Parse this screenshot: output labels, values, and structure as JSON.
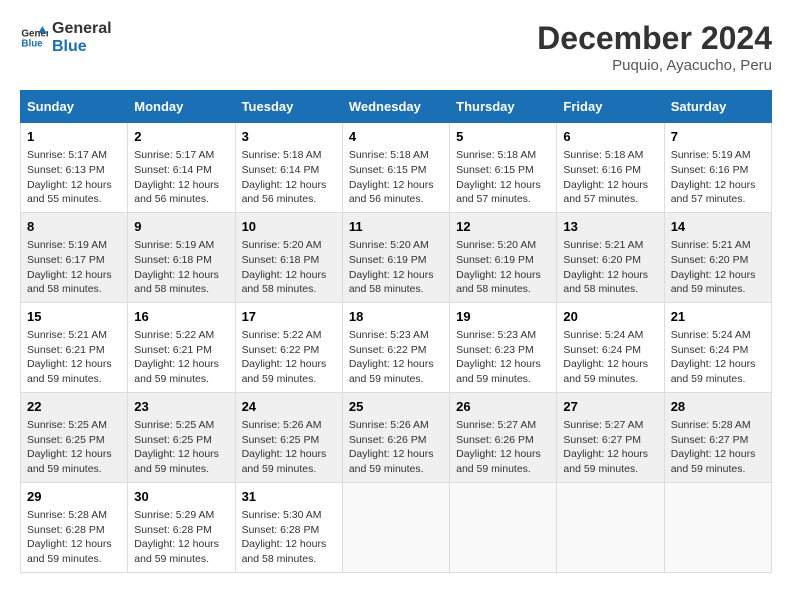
{
  "logo": {
    "line1": "General",
    "line2": "Blue"
  },
  "title": "December 2024",
  "subtitle": "Puquio, Ayacucho, Peru",
  "days_of_week": [
    "Sunday",
    "Monday",
    "Tuesday",
    "Wednesday",
    "Thursday",
    "Friday",
    "Saturday"
  ],
  "weeks": [
    [
      {
        "day": "1",
        "sunrise": "Sunrise: 5:17 AM",
        "sunset": "Sunset: 6:13 PM",
        "daylight": "Daylight: 12 hours and 55 minutes."
      },
      {
        "day": "2",
        "sunrise": "Sunrise: 5:17 AM",
        "sunset": "Sunset: 6:14 PM",
        "daylight": "Daylight: 12 hours and 56 minutes."
      },
      {
        "day": "3",
        "sunrise": "Sunrise: 5:18 AM",
        "sunset": "Sunset: 6:14 PM",
        "daylight": "Daylight: 12 hours and 56 minutes."
      },
      {
        "day": "4",
        "sunrise": "Sunrise: 5:18 AM",
        "sunset": "Sunset: 6:15 PM",
        "daylight": "Daylight: 12 hours and 56 minutes."
      },
      {
        "day": "5",
        "sunrise": "Sunrise: 5:18 AM",
        "sunset": "Sunset: 6:15 PM",
        "daylight": "Daylight: 12 hours and 57 minutes."
      },
      {
        "day": "6",
        "sunrise": "Sunrise: 5:18 AM",
        "sunset": "Sunset: 6:16 PM",
        "daylight": "Daylight: 12 hours and 57 minutes."
      },
      {
        "day": "7",
        "sunrise": "Sunrise: 5:19 AM",
        "sunset": "Sunset: 6:16 PM",
        "daylight": "Daylight: 12 hours and 57 minutes."
      }
    ],
    [
      {
        "day": "8",
        "sunrise": "Sunrise: 5:19 AM",
        "sunset": "Sunset: 6:17 PM",
        "daylight": "Daylight: 12 hours and 58 minutes."
      },
      {
        "day": "9",
        "sunrise": "Sunrise: 5:19 AM",
        "sunset": "Sunset: 6:18 PM",
        "daylight": "Daylight: 12 hours and 58 minutes."
      },
      {
        "day": "10",
        "sunrise": "Sunrise: 5:20 AM",
        "sunset": "Sunset: 6:18 PM",
        "daylight": "Daylight: 12 hours and 58 minutes."
      },
      {
        "day": "11",
        "sunrise": "Sunrise: 5:20 AM",
        "sunset": "Sunset: 6:19 PM",
        "daylight": "Daylight: 12 hours and 58 minutes."
      },
      {
        "day": "12",
        "sunrise": "Sunrise: 5:20 AM",
        "sunset": "Sunset: 6:19 PM",
        "daylight": "Daylight: 12 hours and 58 minutes."
      },
      {
        "day": "13",
        "sunrise": "Sunrise: 5:21 AM",
        "sunset": "Sunset: 6:20 PM",
        "daylight": "Daylight: 12 hours and 58 minutes."
      },
      {
        "day": "14",
        "sunrise": "Sunrise: 5:21 AM",
        "sunset": "Sunset: 6:20 PM",
        "daylight": "Daylight: 12 hours and 59 minutes."
      }
    ],
    [
      {
        "day": "15",
        "sunrise": "Sunrise: 5:21 AM",
        "sunset": "Sunset: 6:21 PM",
        "daylight": "Daylight: 12 hours and 59 minutes."
      },
      {
        "day": "16",
        "sunrise": "Sunrise: 5:22 AM",
        "sunset": "Sunset: 6:21 PM",
        "daylight": "Daylight: 12 hours and 59 minutes."
      },
      {
        "day": "17",
        "sunrise": "Sunrise: 5:22 AM",
        "sunset": "Sunset: 6:22 PM",
        "daylight": "Daylight: 12 hours and 59 minutes."
      },
      {
        "day": "18",
        "sunrise": "Sunrise: 5:23 AM",
        "sunset": "Sunset: 6:22 PM",
        "daylight": "Daylight: 12 hours and 59 minutes."
      },
      {
        "day": "19",
        "sunrise": "Sunrise: 5:23 AM",
        "sunset": "Sunset: 6:23 PM",
        "daylight": "Daylight: 12 hours and 59 minutes."
      },
      {
        "day": "20",
        "sunrise": "Sunrise: 5:24 AM",
        "sunset": "Sunset: 6:24 PM",
        "daylight": "Daylight: 12 hours and 59 minutes."
      },
      {
        "day": "21",
        "sunrise": "Sunrise: 5:24 AM",
        "sunset": "Sunset: 6:24 PM",
        "daylight": "Daylight: 12 hours and 59 minutes."
      }
    ],
    [
      {
        "day": "22",
        "sunrise": "Sunrise: 5:25 AM",
        "sunset": "Sunset: 6:25 PM",
        "daylight": "Daylight: 12 hours and 59 minutes."
      },
      {
        "day": "23",
        "sunrise": "Sunrise: 5:25 AM",
        "sunset": "Sunset: 6:25 PM",
        "daylight": "Daylight: 12 hours and 59 minutes."
      },
      {
        "day": "24",
        "sunrise": "Sunrise: 5:26 AM",
        "sunset": "Sunset: 6:25 PM",
        "daylight": "Daylight: 12 hours and 59 minutes."
      },
      {
        "day": "25",
        "sunrise": "Sunrise: 5:26 AM",
        "sunset": "Sunset: 6:26 PM",
        "daylight": "Daylight: 12 hours and 59 minutes."
      },
      {
        "day": "26",
        "sunrise": "Sunrise: 5:27 AM",
        "sunset": "Sunset: 6:26 PM",
        "daylight": "Daylight: 12 hours and 59 minutes."
      },
      {
        "day": "27",
        "sunrise": "Sunrise: 5:27 AM",
        "sunset": "Sunset: 6:27 PM",
        "daylight": "Daylight: 12 hours and 59 minutes."
      },
      {
        "day": "28",
        "sunrise": "Sunrise: 5:28 AM",
        "sunset": "Sunset: 6:27 PM",
        "daylight": "Daylight: 12 hours and 59 minutes."
      }
    ],
    [
      {
        "day": "29",
        "sunrise": "Sunrise: 5:28 AM",
        "sunset": "Sunset: 6:28 PM",
        "daylight": "Daylight: 12 hours and 59 minutes."
      },
      {
        "day": "30",
        "sunrise": "Sunrise: 5:29 AM",
        "sunset": "Sunset: 6:28 PM",
        "daylight": "Daylight: 12 hours and 59 minutes."
      },
      {
        "day": "31",
        "sunrise": "Sunrise: 5:30 AM",
        "sunset": "Sunset: 6:28 PM",
        "daylight": "Daylight: 12 hours and 58 minutes."
      },
      null,
      null,
      null,
      null
    ]
  ]
}
